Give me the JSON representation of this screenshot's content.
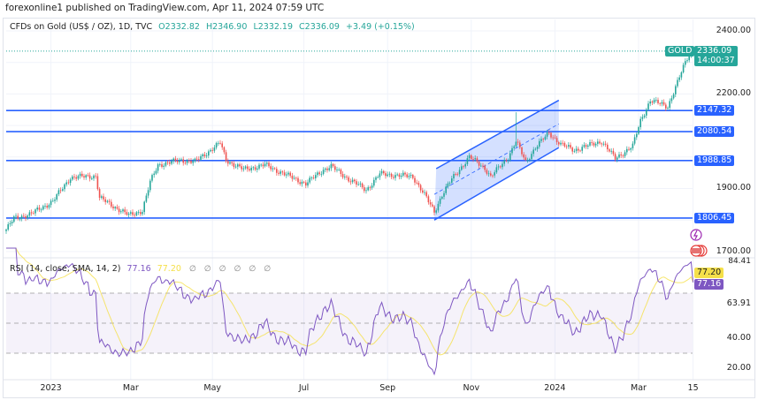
{
  "header": {
    "published": "forexonline1 published on TradingView.com, Apr 11, 2024 07:59 UTC"
  },
  "legend": {
    "symbol": "CFDs on Gold (US$ / OZ), 1D, TVC",
    "open": "O2332.82",
    "high": "H2346.90",
    "low": "L2332.19",
    "close": "C2336.09",
    "change": "+3.49 (+0.15%)"
  },
  "rsi_legend": {
    "title": "RSI (14, close, SMA, 14, 2)",
    "rsi": "77.16",
    "sma": "77.20",
    "nulls": [
      "∅",
      "∅",
      "∅",
      "∅",
      "∅",
      "∅"
    ]
  },
  "price_axis": [
    "2400.00",
    "2200.00",
    "1900.00",
    "1700.00"
  ],
  "price_axis_values": [
    2400,
    2200,
    1900,
    1700
  ],
  "price_tag": {
    "symbol": "GOLD",
    "price": "2336.09",
    "countdown": "14:00:37",
    "value": 2336.09
  },
  "levels": [
    {
      "label": "2147.32",
      "value": 2147.32
    },
    {
      "label": "2080.54",
      "value": 2080.54
    },
    {
      "label": "1988.85",
      "value": 1988.85
    },
    {
      "label": "1806.45",
      "value": 1806.45
    }
  ],
  "rsi_axis": {
    "top": "84.41",
    "sma_tag": "77.20",
    "rsi_tag": "77.16",
    "mid": "63.91",
    "l40": "40.00",
    "l20": "20.00"
  },
  "time_axis": [
    {
      "label": "2023",
      "day": 23
    },
    {
      "label": "Mar",
      "day": 64
    },
    {
      "label": "May",
      "day": 106
    },
    {
      "label": "Jul",
      "day": 153
    },
    {
      "label": "Sep",
      "day": 196
    },
    {
      "label": "Nov",
      "day": 239
    },
    {
      "label": "2024",
      "day": 282
    },
    {
      "label": "Mar",
      "day": 325
    },
    {
      "label": "15",
      "day": 353
    }
  ],
  "colors": {
    "up": "#26a69a",
    "down": "#ef5350",
    "level": "#2962ff",
    "rsi": "#7e57c2",
    "sma": "#f5e04a"
  },
  "chart_data": {
    "type": "candlestick",
    "title": "CFDs on Gold (US$ / OZ), 1D, TVC",
    "ylim": [
      1680,
      2420
    ],
    "close_keypoints": [
      [
        0,
        1770
      ],
      [
        4,
        1805
      ],
      [
        13,
        1820
      ],
      [
        24,
        1860
      ],
      [
        33,
        1935
      ],
      [
        46,
        1940
      ],
      [
        48,
        1870
      ],
      [
        63,
        1815
      ],
      [
        70,
        1830
      ],
      [
        74,
        1920
      ],
      [
        78,
        1975
      ],
      [
        90,
        1990
      ],
      [
        97,
        1985
      ],
      [
        110,
        2045
      ],
      [
        113,
        1990
      ],
      [
        122,
        1960
      ],
      [
        133,
        1975
      ],
      [
        145,
        1940
      ],
      [
        154,
        1915
      ],
      [
        163,
        1960
      ],
      [
        167,
        1970
      ],
      [
        176,
        1930
      ],
      [
        185,
        1895
      ],
      [
        192,
        1946
      ],
      [
        209,
        1938
      ],
      [
        215,
        1880
      ],
      [
        220,
        1826
      ],
      [
        224,
        1880
      ],
      [
        229,
        1930
      ],
      [
        238,
        2000
      ],
      [
        246,
        1965
      ],
      [
        249,
        1937
      ],
      [
        258,
        2000
      ],
      [
        262,
        2050
      ],
      [
        267,
        1985
      ],
      [
        272,
        2030
      ],
      [
        279,
        2077
      ],
      [
        285,
        2040
      ],
      [
        292,
        2022
      ],
      [
        306,
        2050
      ],
      [
        313,
        1995
      ],
      [
        322,
        2035
      ],
      [
        326,
        2115
      ],
      [
        331,
        2180
      ],
      [
        340,
        2160
      ],
      [
        345,
        2237
      ],
      [
        349,
        2300
      ],
      [
        352,
        2340
      ],
      [
        353,
        2336.09
      ]
    ],
    "spikes": [
      {
        "day": 262,
        "high": 2142
      }
    ],
    "channel": {
      "lower": [
        [
          220,
          1800
        ],
        [
          284,
          2030
        ]
      ],
      "upper": [
        [
          221,
          1963
        ],
        [
          284,
          2180
        ]
      ]
    },
    "rsi": {
      "period": 14,
      "sma_period": 14,
      "bands": [
        70,
        50,
        30
      ],
      "last": 77.16,
      "last_sma": 77.2
    }
  }
}
